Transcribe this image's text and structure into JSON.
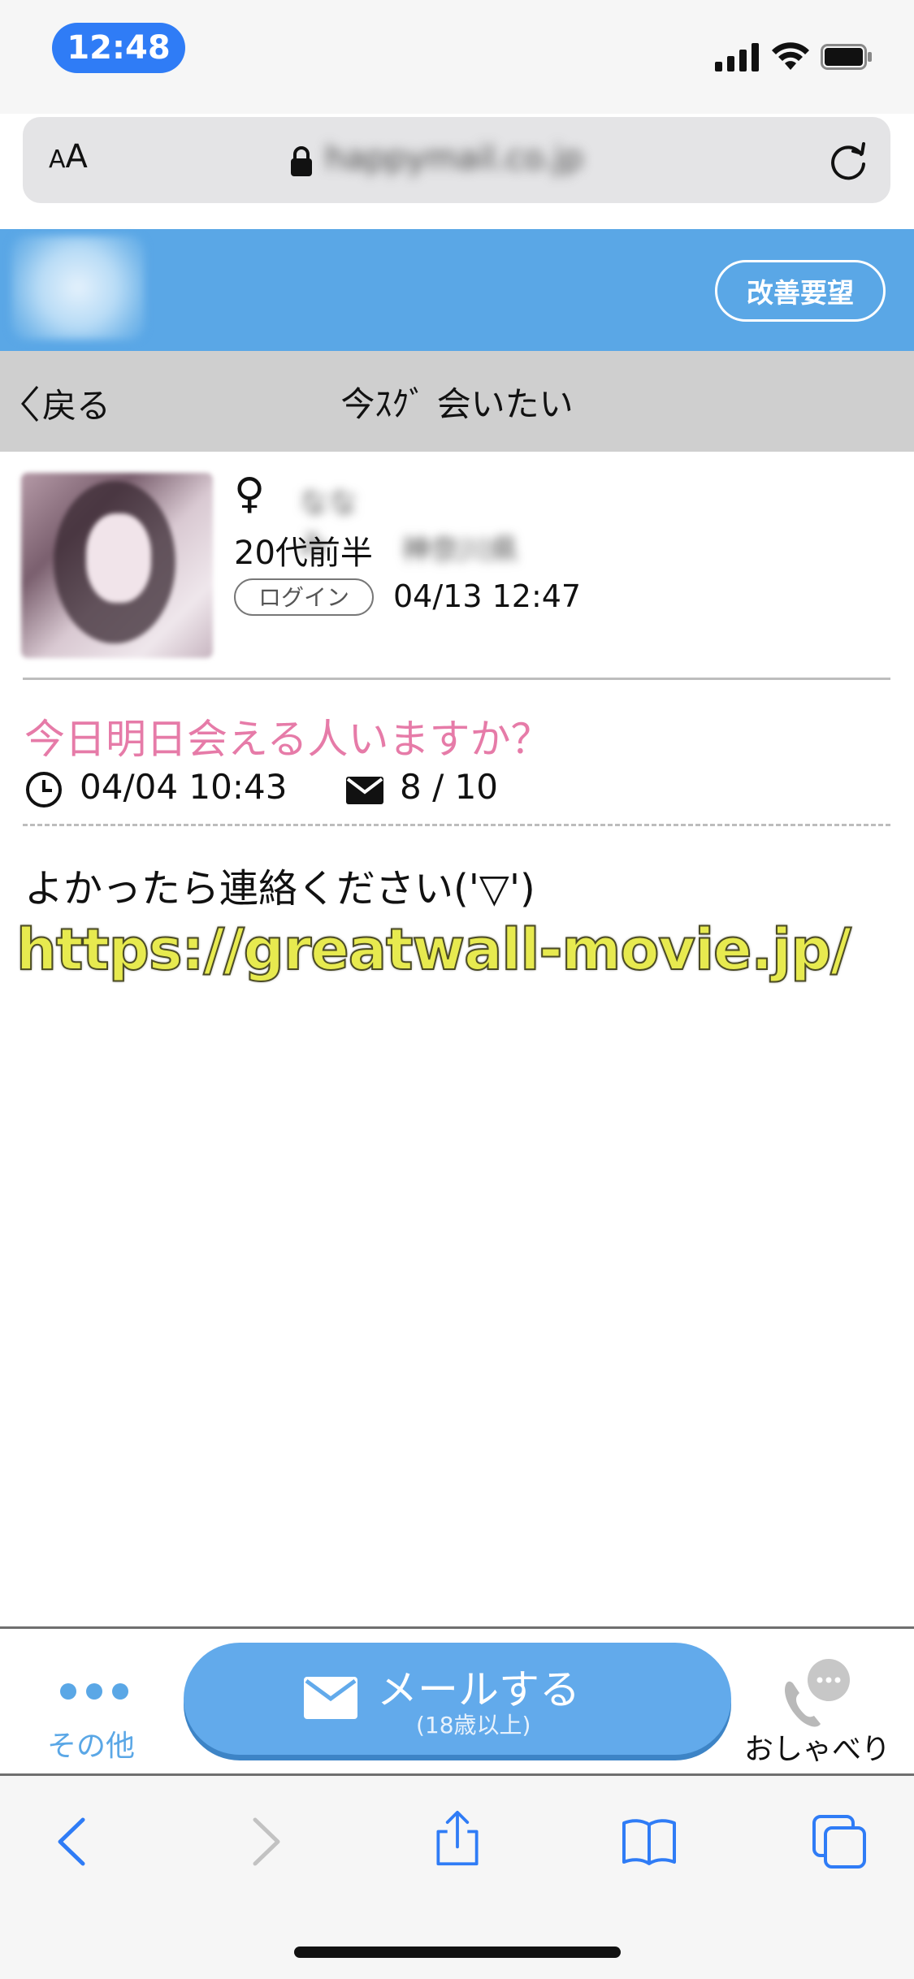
{
  "status_bar": {
    "time": "12:48"
  },
  "browser": {
    "text_size_label_small": "A",
    "text_size_label_large": "A",
    "url": "happymail.co.jp"
  },
  "header": {
    "improve_button": "改善要望"
  },
  "nav": {
    "back_label": "戻る",
    "title": "今ｽｸﾞ 会いたい"
  },
  "profile": {
    "gender_symbol": "♀",
    "name": "ななみ",
    "age": "20代前半",
    "area": "神奈川県",
    "login_badge": "ログイン",
    "login_time": "04/13 12:47"
  },
  "post": {
    "title": "今日明日会える人いますか？",
    "date": "04/04 10:43",
    "mail_count": "8 / 10",
    "body": "よかったら連絡ください('▽')"
  },
  "watermark": "https://greatwall-movie.jp/",
  "action_bar": {
    "other_label": "その他",
    "mail_button_label": "メールする",
    "mail_button_sub": "(18歳以上)",
    "talk_label": "おしゃべり"
  },
  "colors": {
    "accent_blue": "#5aa7e6",
    "pink_title": "#e67ba8",
    "nav_gray": "#cfcfcf",
    "time_pill": "#2f7cf6"
  }
}
